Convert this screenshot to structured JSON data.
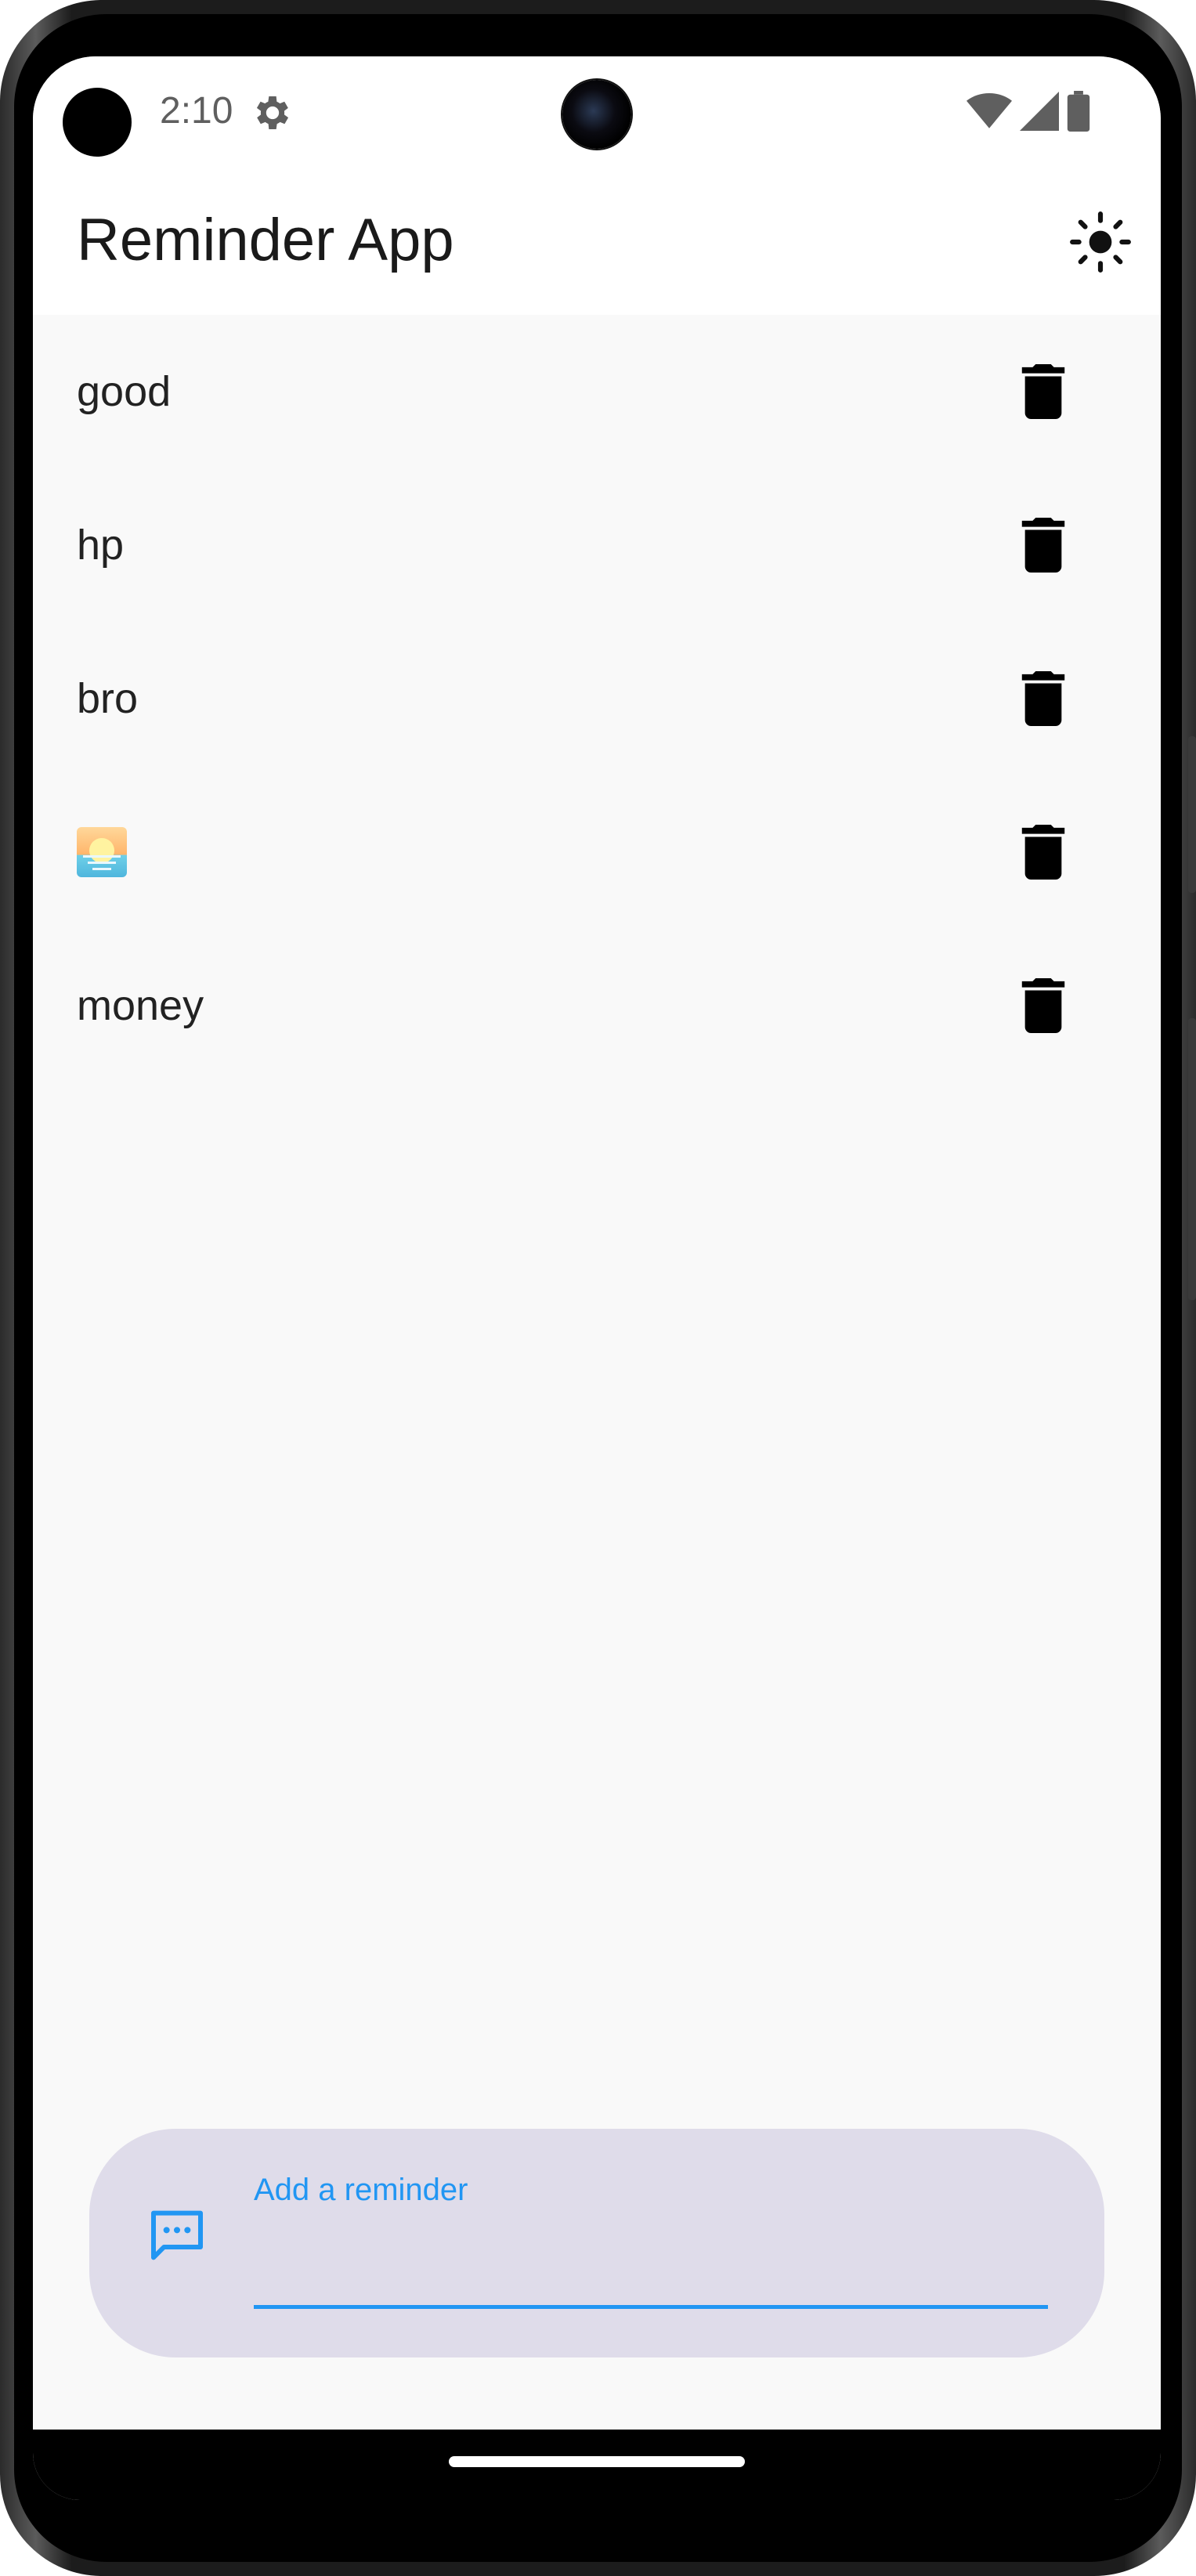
{
  "status_bar": {
    "time": "2:10",
    "icons": [
      "gear-icon",
      "wifi-icon",
      "signal-icon",
      "battery-icon"
    ]
  },
  "app_bar": {
    "title": "Reminder App",
    "theme_toggle_icon": "sun-icon"
  },
  "reminders": [
    {
      "text": "good",
      "delete_icon": "trash-icon"
    },
    {
      "text": "hp",
      "delete_icon": "trash-icon"
    },
    {
      "text": "bro",
      "delete_icon": "trash-icon"
    },
    {
      "text": "",
      "emoji": "sunrise-emoji",
      "delete_icon": "trash-icon"
    },
    {
      "text": "money",
      "delete_icon": "trash-icon"
    }
  ],
  "input_panel": {
    "label": "Add a reminder",
    "value": "",
    "icon": "message-icon"
  },
  "colors": {
    "accent": "#2196f3",
    "panel_bg": "#dfdcea",
    "list_bg": "#f9f9f9"
  }
}
